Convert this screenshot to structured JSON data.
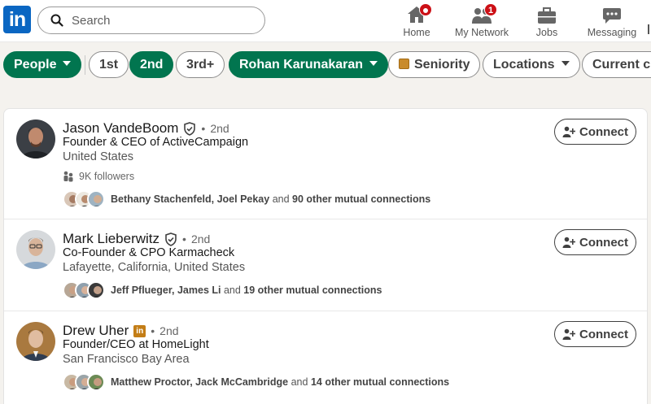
{
  "header": {
    "logo_text": "in",
    "search_placeholder": "Search",
    "nav": [
      {
        "label": "Home",
        "icon": "home-icon",
        "badge": ""
      },
      {
        "label": "My Network",
        "icon": "network-icon",
        "badge": "1"
      },
      {
        "label": "Jobs",
        "icon": "briefcase-icon",
        "badge": ""
      },
      {
        "label": "Messaging",
        "icon": "messaging-icon",
        "badge": ""
      }
    ]
  },
  "filters": {
    "people": "People",
    "first": "1st",
    "second": "2nd",
    "third": "3rd+",
    "connection_of": "Rohan Karunakaran",
    "seniority": "Seniority",
    "locations": "Locations",
    "current_company": "Current c"
  },
  "results": [
    {
      "name": "Jason VandeBoom",
      "degree": "2nd",
      "headline": "Founder & CEO of ActiveCampaign",
      "location": "United States",
      "followers": "9K followers",
      "mutual_names": "Bethany Stachenfeld, Joel Pekay",
      "mutual_rest": " and ",
      "mutual_count": "90 other mutual connections",
      "connect": "Connect"
    },
    {
      "name": "Mark Lieberwitz",
      "degree": "2nd",
      "headline": "Co-Founder & CPO Karmacheck",
      "location": "Lafayette, California, United States",
      "mutual_names": "Jeff Pflueger, James Li",
      "mutual_rest": " and ",
      "mutual_count": "19 other mutual connections",
      "connect": "Connect"
    },
    {
      "name": "Drew Uher",
      "degree": "2nd",
      "headline": "Founder/CEO at HomeLight",
      "location": "San Francisco Bay Area",
      "mutual_names": "Matthew Proctor, Jack McCambridge",
      "mutual_rest": " and ",
      "mutual_count": "14 other mutual connections",
      "connect": "Connect"
    }
  ],
  "colors": {
    "brand": "#0a66c2",
    "filter_active": "#01754f",
    "badge": "#cc1016"
  }
}
